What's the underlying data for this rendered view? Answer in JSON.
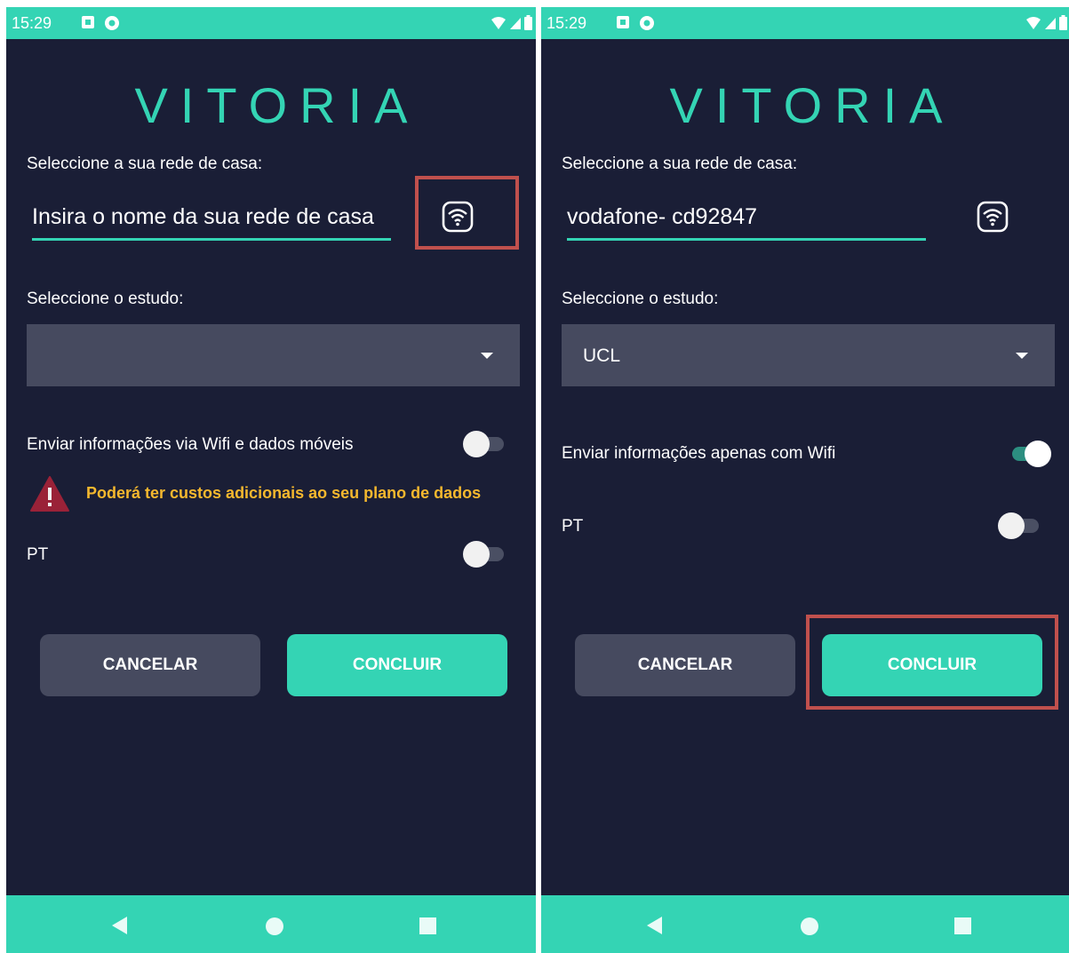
{
  "screens": {
    "left": {
      "status": {
        "time": "15:29"
      },
      "title": "VITORIA",
      "network": {
        "label": "Seleccione a sua rede de casa:",
        "input_placeholder": "Insira o nome da sua rede de casa"
      },
      "study": {
        "label": "Seleccione o estudo:",
        "selected": ""
      },
      "wifi_toggle": {
        "label": "Enviar informações via Wifi e dados móveis",
        "state": "off"
      },
      "warning": {
        "text": "Poderá ter custos adicionais ao seu plano de dados",
        "color": "#f5b82e"
      },
      "pt_toggle": {
        "label": "PT",
        "state": "off"
      },
      "buttons": {
        "cancel": "CANCELAR",
        "confirm": "CONCLUIR"
      }
    },
    "right": {
      "status": {
        "time": "15:29"
      },
      "title": "VITORIA",
      "network": {
        "label": "Seleccione a sua rede de casa:",
        "input_value": "vodafone- cd92847"
      },
      "study": {
        "label": "Seleccione o estudo:",
        "selected": "UCL"
      },
      "wifi_toggle": {
        "label": "Enviar informações apenas com Wifi",
        "state": "on"
      },
      "pt_toggle": {
        "label": "PT",
        "state": "off"
      },
      "buttons": {
        "cancel": "CANCELAR",
        "confirm": "CONCLUIR"
      }
    }
  },
  "colors": {
    "accent": "#34d4b4",
    "background": "#1a1e36",
    "control": "#464a5f",
    "highlight": "#c0504d"
  },
  "icons": [
    "wifi-icon",
    "warning-icon",
    "nav-back-icon",
    "nav-home-icon",
    "nav-recents-icon",
    "wifi-signal-icon",
    "battery-icon",
    "notification-icon"
  ]
}
